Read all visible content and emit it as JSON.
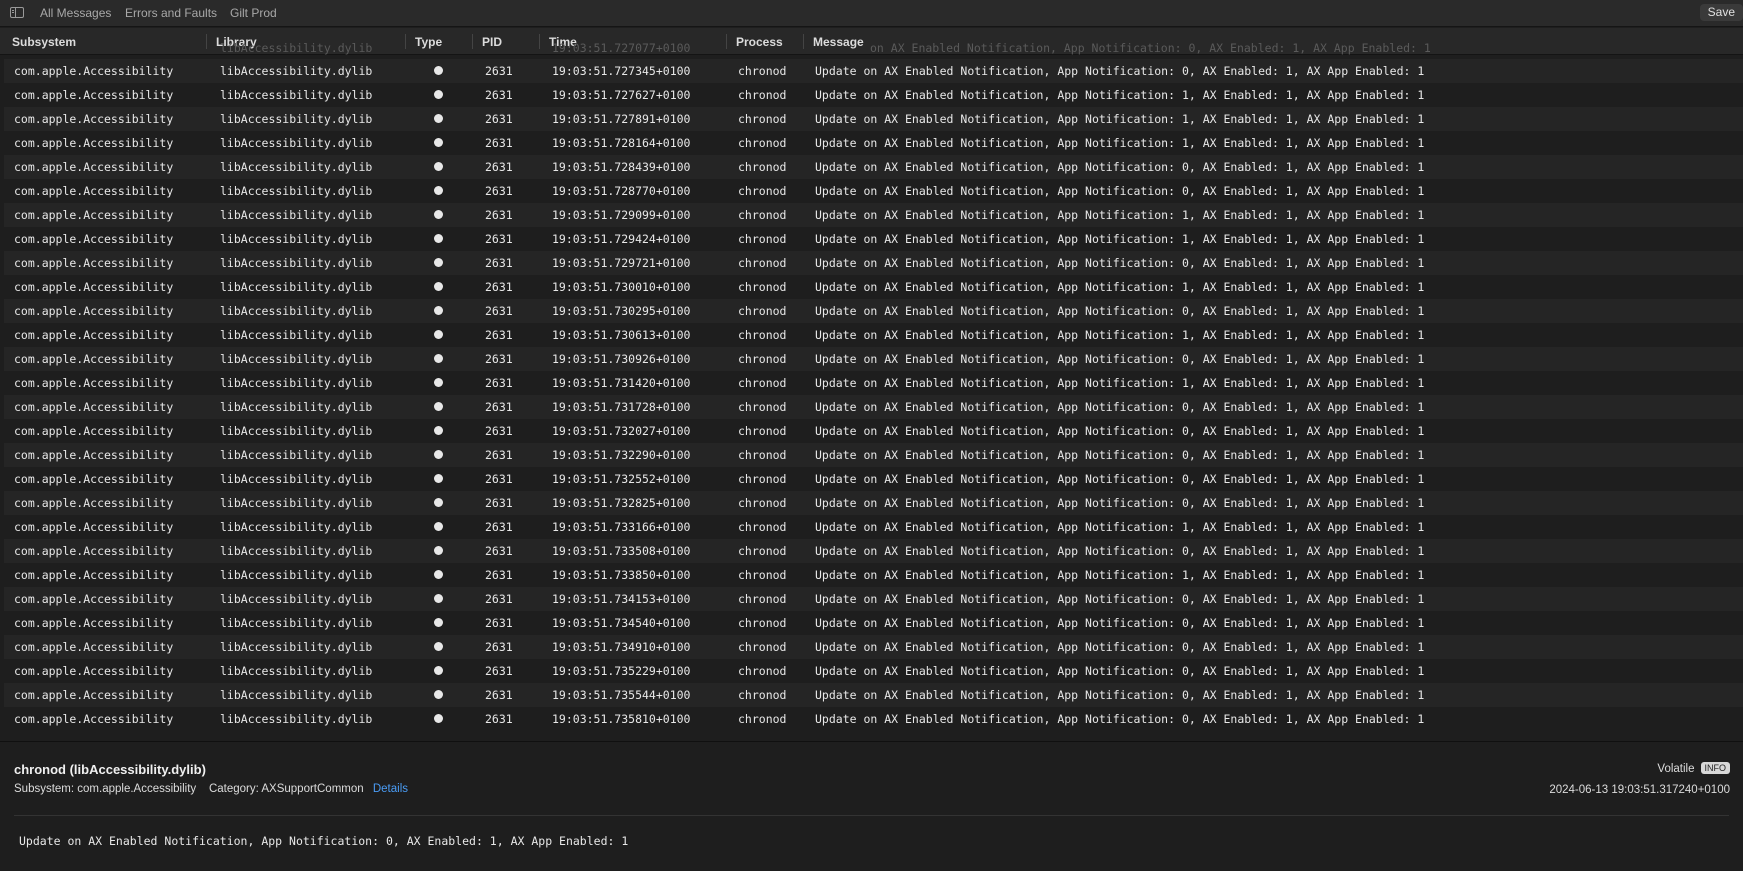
{
  "toolbar": {
    "tabs": [
      "All Messages",
      "Errors and Faults",
      "Gilt Prod"
    ],
    "save_label": "Save"
  },
  "columns": [
    "Subsystem",
    "Library",
    "Type",
    "PID",
    "Time",
    "Process",
    "Message"
  ],
  "ghost_row": {
    "library": "libAccessibility.dylib",
    "time": "19:03:51.727077+0100",
    "message": "on AX Enabled Notification, App Notification: 0, AX Enabled: 1, AX App Enabled: 1"
  },
  "rows": [
    {
      "subsystem": "com.apple.Accessibility",
      "library": "libAccessibility.dylib",
      "pid": "2631",
      "time": "19:03:51.727345+0100",
      "process": "chronod",
      "message": "Update on AX Enabled Notification, App Notification: 0, AX Enabled: 1, AX App Enabled: 1"
    },
    {
      "subsystem": "com.apple.Accessibility",
      "library": "libAccessibility.dylib",
      "pid": "2631",
      "time": "19:03:51.727627+0100",
      "process": "chronod",
      "message": "Update on AX Enabled Notification, App Notification: 1, AX Enabled: 1, AX App Enabled: 1"
    },
    {
      "subsystem": "com.apple.Accessibility",
      "library": "libAccessibility.dylib",
      "pid": "2631",
      "time": "19:03:51.727891+0100",
      "process": "chronod",
      "message": "Update on AX Enabled Notification, App Notification: 1, AX Enabled: 1, AX App Enabled: 1"
    },
    {
      "subsystem": "com.apple.Accessibility",
      "library": "libAccessibility.dylib",
      "pid": "2631",
      "time": "19:03:51.728164+0100",
      "process": "chronod",
      "message": "Update on AX Enabled Notification, App Notification: 1, AX Enabled: 1, AX App Enabled: 1"
    },
    {
      "subsystem": "com.apple.Accessibility",
      "library": "libAccessibility.dylib",
      "pid": "2631",
      "time": "19:03:51.728439+0100",
      "process": "chronod",
      "message": "Update on AX Enabled Notification, App Notification: 0, AX Enabled: 1, AX App Enabled: 1"
    },
    {
      "subsystem": "com.apple.Accessibility",
      "library": "libAccessibility.dylib",
      "pid": "2631",
      "time": "19:03:51.728770+0100",
      "process": "chronod",
      "message": "Update on AX Enabled Notification, App Notification: 0, AX Enabled: 1, AX App Enabled: 1"
    },
    {
      "subsystem": "com.apple.Accessibility",
      "library": "libAccessibility.dylib",
      "pid": "2631",
      "time": "19:03:51.729099+0100",
      "process": "chronod",
      "message": "Update on AX Enabled Notification, App Notification: 1, AX Enabled: 1, AX App Enabled: 1"
    },
    {
      "subsystem": "com.apple.Accessibility",
      "library": "libAccessibility.dylib",
      "pid": "2631",
      "time": "19:03:51.729424+0100",
      "process": "chronod",
      "message": "Update on AX Enabled Notification, App Notification: 1, AX Enabled: 1, AX App Enabled: 1"
    },
    {
      "subsystem": "com.apple.Accessibility",
      "library": "libAccessibility.dylib",
      "pid": "2631",
      "time": "19:03:51.729721+0100",
      "process": "chronod",
      "message": "Update on AX Enabled Notification, App Notification: 0, AX Enabled: 1, AX App Enabled: 1"
    },
    {
      "subsystem": "com.apple.Accessibility",
      "library": "libAccessibility.dylib",
      "pid": "2631",
      "time": "19:03:51.730010+0100",
      "process": "chronod",
      "message": "Update on AX Enabled Notification, App Notification: 1, AX Enabled: 1, AX App Enabled: 1"
    },
    {
      "subsystem": "com.apple.Accessibility",
      "library": "libAccessibility.dylib",
      "pid": "2631",
      "time": "19:03:51.730295+0100",
      "process": "chronod",
      "message": "Update on AX Enabled Notification, App Notification: 0, AX Enabled: 1, AX App Enabled: 1"
    },
    {
      "subsystem": "com.apple.Accessibility",
      "library": "libAccessibility.dylib",
      "pid": "2631",
      "time": "19:03:51.730613+0100",
      "process": "chronod",
      "message": "Update on AX Enabled Notification, App Notification: 1, AX Enabled: 1, AX App Enabled: 1"
    },
    {
      "subsystem": "com.apple.Accessibility",
      "library": "libAccessibility.dylib",
      "pid": "2631",
      "time": "19:03:51.730926+0100",
      "process": "chronod",
      "message": "Update on AX Enabled Notification, App Notification: 0, AX Enabled: 1, AX App Enabled: 1"
    },
    {
      "subsystem": "com.apple.Accessibility",
      "library": "libAccessibility.dylib",
      "pid": "2631",
      "time": "19:03:51.731420+0100",
      "process": "chronod",
      "message": "Update on AX Enabled Notification, App Notification: 1, AX Enabled: 1, AX App Enabled: 1"
    },
    {
      "subsystem": "com.apple.Accessibility",
      "library": "libAccessibility.dylib",
      "pid": "2631",
      "time": "19:03:51.731728+0100",
      "process": "chronod",
      "message": "Update on AX Enabled Notification, App Notification: 0, AX Enabled: 1, AX App Enabled: 1"
    },
    {
      "subsystem": "com.apple.Accessibility",
      "library": "libAccessibility.dylib",
      "pid": "2631",
      "time": "19:03:51.732027+0100",
      "process": "chronod",
      "message": "Update on AX Enabled Notification, App Notification: 0, AX Enabled: 1, AX App Enabled: 1"
    },
    {
      "subsystem": "com.apple.Accessibility",
      "library": "libAccessibility.dylib",
      "pid": "2631",
      "time": "19:03:51.732290+0100",
      "process": "chronod",
      "message": "Update on AX Enabled Notification, App Notification: 0, AX Enabled: 1, AX App Enabled: 1"
    },
    {
      "subsystem": "com.apple.Accessibility",
      "library": "libAccessibility.dylib",
      "pid": "2631",
      "time": "19:03:51.732552+0100",
      "process": "chronod",
      "message": "Update on AX Enabled Notification, App Notification: 0, AX Enabled: 1, AX App Enabled: 1"
    },
    {
      "subsystem": "com.apple.Accessibility",
      "library": "libAccessibility.dylib",
      "pid": "2631",
      "time": "19:03:51.732825+0100",
      "process": "chronod",
      "message": "Update on AX Enabled Notification, App Notification: 0, AX Enabled: 1, AX App Enabled: 1"
    },
    {
      "subsystem": "com.apple.Accessibility",
      "library": "libAccessibility.dylib",
      "pid": "2631",
      "time": "19:03:51.733166+0100",
      "process": "chronod",
      "message": "Update on AX Enabled Notification, App Notification: 1, AX Enabled: 1, AX App Enabled: 1"
    },
    {
      "subsystem": "com.apple.Accessibility",
      "library": "libAccessibility.dylib",
      "pid": "2631",
      "time": "19:03:51.733508+0100",
      "process": "chronod",
      "message": "Update on AX Enabled Notification, App Notification: 0, AX Enabled: 1, AX App Enabled: 1"
    },
    {
      "subsystem": "com.apple.Accessibility",
      "library": "libAccessibility.dylib",
      "pid": "2631",
      "time": "19:03:51.733850+0100",
      "process": "chronod",
      "message": "Update on AX Enabled Notification, App Notification: 1, AX Enabled: 1, AX App Enabled: 1"
    },
    {
      "subsystem": "com.apple.Accessibility",
      "library": "libAccessibility.dylib",
      "pid": "2631",
      "time": "19:03:51.734153+0100",
      "process": "chronod",
      "message": "Update on AX Enabled Notification, App Notification: 0, AX Enabled: 1, AX App Enabled: 1"
    },
    {
      "subsystem": "com.apple.Accessibility",
      "library": "libAccessibility.dylib",
      "pid": "2631",
      "time": "19:03:51.734540+0100",
      "process": "chronod",
      "message": "Update on AX Enabled Notification, App Notification: 0, AX Enabled: 1, AX App Enabled: 1"
    },
    {
      "subsystem": "com.apple.Accessibility",
      "library": "libAccessibility.dylib",
      "pid": "2631",
      "time": "19:03:51.734910+0100",
      "process": "chronod",
      "message": "Update on AX Enabled Notification, App Notification: 0, AX Enabled: 1, AX App Enabled: 1"
    },
    {
      "subsystem": "com.apple.Accessibility",
      "library": "libAccessibility.dylib",
      "pid": "2631",
      "time": "19:03:51.735229+0100",
      "process": "chronod",
      "message": "Update on AX Enabled Notification, App Notification: 0, AX Enabled: 1, AX App Enabled: 1"
    },
    {
      "subsystem": "com.apple.Accessibility",
      "library": "libAccessibility.dylib",
      "pid": "2631",
      "time": "19:03:51.735544+0100",
      "process": "chronod",
      "message": "Update on AX Enabled Notification, App Notification: 0, AX Enabled: 1, AX App Enabled: 1"
    },
    {
      "subsystem": "com.apple.Accessibility",
      "library": "libAccessibility.dylib",
      "pid": "2631",
      "time": "19:03:51.735810+0100",
      "process": "chronod",
      "message": "Update on AX Enabled Notification, App Notification: 0, AX Enabled: 1, AX App Enabled: 1"
    }
  ],
  "detail": {
    "title": "chronod (libAccessibility.dylib)",
    "subsystem_label": "Subsystem:",
    "subsystem": "com.apple.Accessibility",
    "category_label": "Category:",
    "category": "AXSupportCommon",
    "details_link": "Details",
    "volatile_label": "Volatile",
    "level": "INFO",
    "timestamp": "2024-06-13 19:03:51.317240+0100",
    "message": "Update on AX Enabled Notification, App Notification: 0, AX Enabled: 1, AX App Enabled: 1"
  }
}
